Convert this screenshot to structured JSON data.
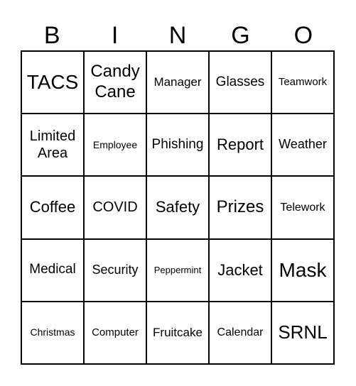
{
  "header": [
    "B",
    "I",
    "N",
    "G",
    "O"
  ],
  "cells": [
    [
      "TACS",
      "Candy Cane",
      "Manager",
      "Glasses",
      "Teamwork"
    ],
    [
      "Limited Area",
      "Employee",
      "Phishing",
      "Report",
      "Weather"
    ],
    [
      "Coffee",
      "COVID",
      "Safety",
      "Prizes",
      "Telework"
    ],
    [
      "Medical",
      "Security",
      "Peppermint",
      "Jacket",
      "Mask"
    ],
    [
      "Christmas",
      "Computer",
      "Fruitcake",
      "Calendar",
      "SRNL"
    ]
  ]
}
